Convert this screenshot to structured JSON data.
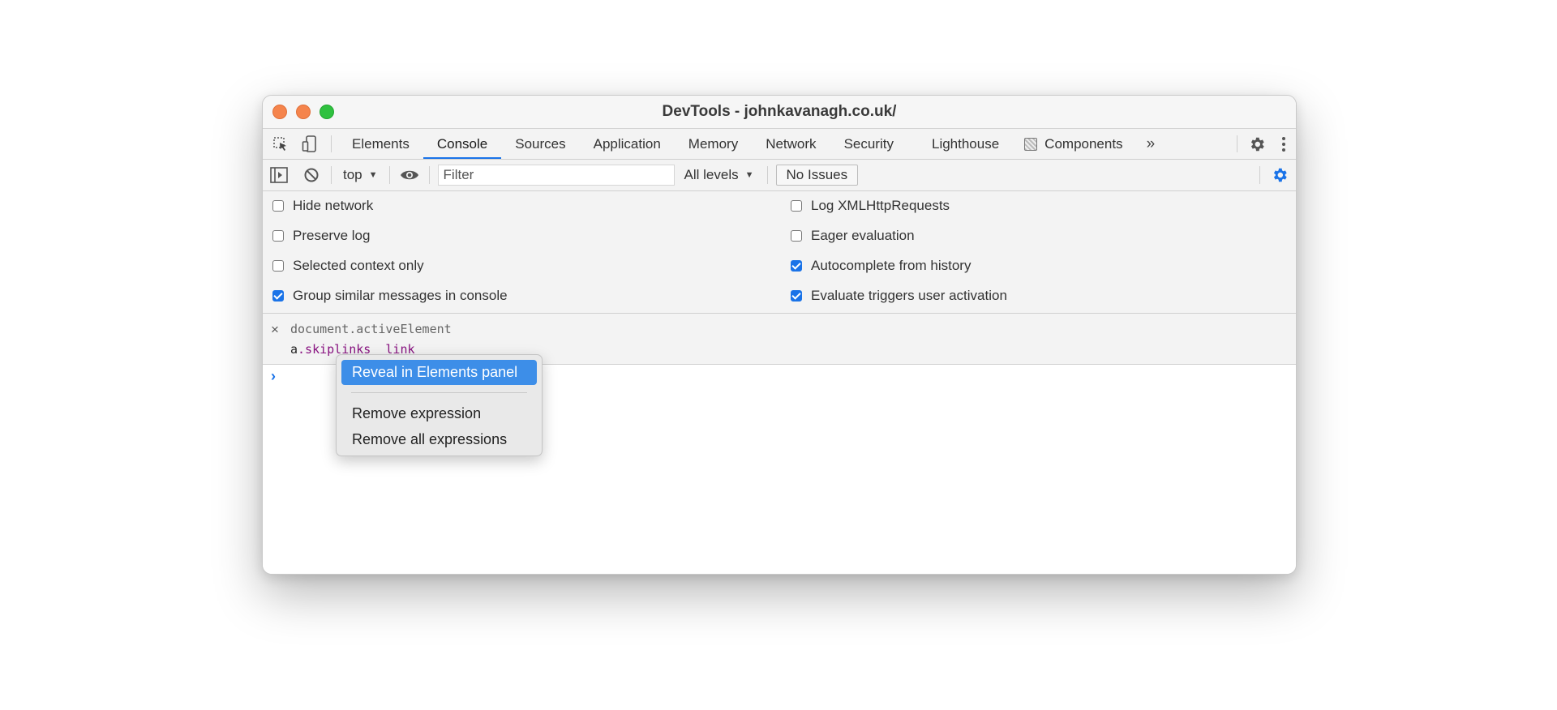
{
  "window": {
    "title": "DevTools - johnkavanagh.co.uk/"
  },
  "tabs": [
    {
      "label": "Elements"
    },
    {
      "label": "Console",
      "active": true
    },
    {
      "label": "Sources"
    },
    {
      "label": "Application"
    },
    {
      "label": "Memory"
    },
    {
      "label": "Network"
    },
    {
      "label": "Security"
    },
    {
      "label": "Lighthouse"
    },
    {
      "label": "Components"
    }
  ],
  "tabbar_icons": {
    "inspect": "inspect-element-icon",
    "device": "device-toolbar-icon",
    "more_tabs": "»",
    "settings": "gear-icon",
    "menu": "kebab-menu-icon"
  },
  "toolbar": {
    "context": "top",
    "filter_placeholder": "Filter",
    "levels": "All levels",
    "issues": "No Issues"
  },
  "settings": {
    "left": [
      {
        "label": "Hide network",
        "checked": false
      },
      {
        "label": "Preserve log",
        "checked": false
      },
      {
        "label": "Selected context only",
        "checked": false
      },
      {
        "label": "Group similar messages in console",
        "checked": true
      }
    ],
    "right": [
      {
        "label": "Log XMLHttpRequests",
        "checked": false
      },
      {
        "label": "Eager evaluation",
        "checked": false
      },
      {
        "label": "Autocomplete from history",
        "checked": true
      },
      {
        "label": "Evaluate triggers user activation",
        "checked": true
      }
    ]
  },
  "live_expression": {
    "close": "×",
    "expression": "document.activeElement",
    "result_prefix": "a",
    "result_class": ".skiplinks__link"
  },
  "console": {
    "prompt": "›"
  },
  "context_menu": {
    "items": [
      {
        "label": "Reveal in Elements panel",
        "selected": true
      },
      {
        "label": "Remove expression"
      },
      {
        "label": "Remove all expressions"
      }
    ]
  },
  "colors": {
    "accent": "#1a73e8",
    "menu_highlight": "#3d8ee8",
    "traffic_close": "#f5844c",
    "traffic_min": "#f5844c",
    "traffic_max": "#2fc13f"
  }
}
